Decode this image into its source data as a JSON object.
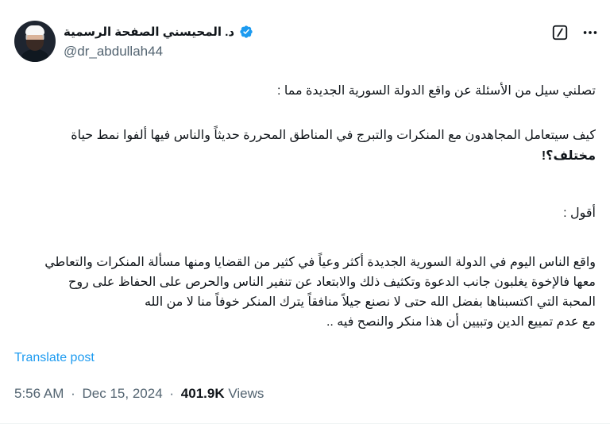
{
  "author": {
    "display_name": "د. المحيسني الصفحة الرسمية",
    "handle": "@dr_abdullah44",
    "verified_icon": "verified-badge-icon",
    "verified_color": "#1d9bf0"
  },
  "actions": {
    "grok_icon": "grok-icon",
    "more_icon": "more-icon"
  },
  "post": {
    "paragraph_1": "تصلني سيل من الأسئلة عن واقع الدولة السورية الجديدة مما :",
    "paragraph_2_line_1": "كيف سيتعامل المجاهدون مع المنكرات والتبرج في المناطق المحررة حديثاً والناس فيها ألفوا نمط حياة",
    "paragraph_2_line_2": "مختلف؟!",
    "paragraph_3": "أقول :",
    "paragraph_4_line_1": "واقع الناس اليوم في الدولة السورية الجديدة أكثر وعياً في كثير من القضايا ومنها مسألة المنكرات والتعاطي",
    "paragraph_4_line_2": "معها فالإخوة يغلبون جانب الدعوة وتكثيف ذلك والابتعاد عن تنفير الناس والحرص على الحفاظ على روح",
    "paragraph_4_line_3": "المحبة التي اكتسبناها بفضل الله حتى لا نصنع جيلاً منافقاً يترك المنكر خوفاً منا لا من الله",
    "paragraph_4_line_4": "مع عدم تمييع الدين وتبيين أن هذا منكر والنصح فيه .."
  },
  "translate_label": "Translate post",
  "meta": {
    "time": "5:56 AM",
    "date": "Dec 15, 2024",
    "separator": "·",
    "views_count": "401.9K",
    "views_label": "Views"
  },
  "colors": {
    "text": "#0f1419",
    "secondary": "#536471",
    "link": "#1d9bf0"
  }
}
